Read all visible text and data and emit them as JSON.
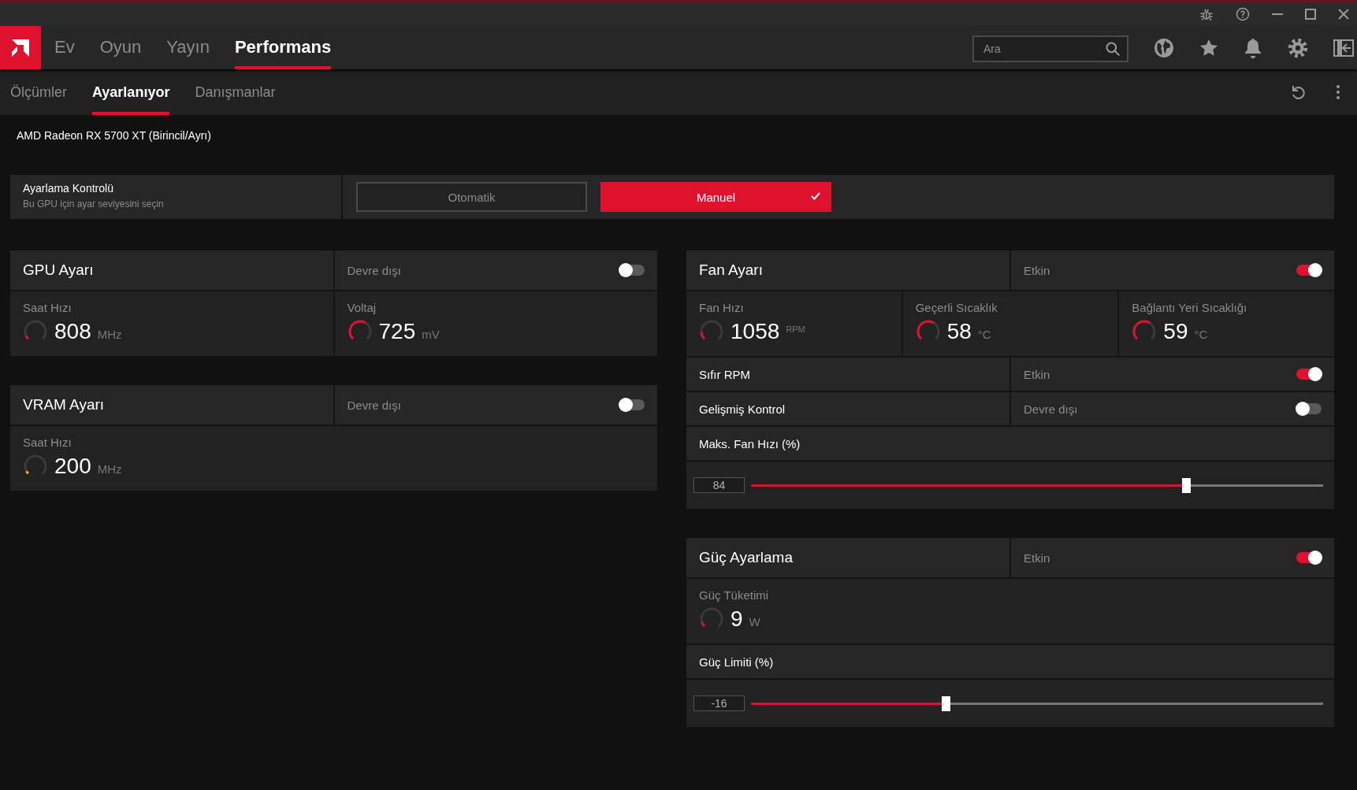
{
  "nav": {
    "tabs": [
      {
        "label": "Ev",
        "selected": false
      },
      {
        "label": "Oyun",
        "selected": false
      },
      {
        "label": "Yayın",
        "selected": false
      },
      {
        "label": "Performans",
        "selected": true
      }
    ],
    "search": {
      "placeholder": "Ara"
    }
  },
  "subnav": {
    "tabs": [
      {
        "label": "Ölçümler",
        "selected": false
      },
      {
        "label": "Ayarlanıyor",
        "selected": true
      },
      {
        "label": "Danışmanlar",
        "selected": false
      }
    ]
  },
  "gpu_name": "AMD Radeon RX 5700 XT (Birincil/Ayrı)",
  "tuning_control": {
    "title": "Ayarlama Kontrolü",
    "subtitle": "Bu GPU için ayar seviyesini seçin",
    "options": [
      {
        "label": "Otomatik",
        "selected": false
      },
      {
        "label": "Manuel",
        "selected": true
      }
    ]
  },
  "left_cards": [
    {
      "title": "GPU Ayarı",
      "status": "Devre dışı",
      "on": false,
      "metrics": [
        {
          "label": "Saat Hızı",
          "value": "808",
          "unit": "MHz",
          "level": 0.08,
          "color": "#e0102f"
        },
        {
          "label": "Voltaj",
          "value": "725",
          "unit": "mV",
          "level": 0.62,
          "color": "#e0102f"
        }
      ]
    },
    {
      "title": "VRAM Ayarı",
      "status": "Devre dışı",
      "on": false,
      "metrics": [
        {
          "label": "Saat Hızı",
          "value": "200",
          "unit": "MHz",
          "level": 0.06,
          "color": "#f0b400"
        }
      ]
    }
  ],
  "right_cards": [
    {
      "title": "Fan Ayarı",
      "status": "Etkin",
      "on": true,
      "metrics": [
        {
          "label": "Fan Hızı",
          "value": "1058",
          "unit": "RPM",
          "level": 0.15,
          "color": "#e0102f"
        },
        {
          "label": "Geçerli Sıcaklık",
          "value": "58",
          "unit": "°C",
          "level": 0.62,
          "color": "#e0102f"
        },
        {
          "label": "Bağlantı Yeri Sıcaklığı",
          "value": "59",
          "unit": "°C",
          "level": 0.62,
          "color": "#e0102f"
        }
      ],
      "rows": [
        {
          "kind": "toggle",
          "label": "Sıfır RPM",
          "status": "Etkin",
          "on": true
        },
        {
          "kind": "toggle",
          "label": "Gelişmiş Kontrol",
          "status": "Devre dışı",
          "on": false
        },
        {
          "kind": "slider",
          "label": "Maks. Fan Hızı (%)",
          "value": "84",
          "level": 0.76
        }
      ]
    },
    {
      "title": "Güç Ayarlama",
      "status": "Etkin",
      "on": true,
      "metrics": [
        {
          "label": "Güç Tüketimi",
          "value": "9",
          "unit": "W",
          "level": 0.1,
          "color": "#e0102f"
        }
      ],
      "rows": [
        {
          "kind": "slider",
          "label": "Güç Limiti (%)",
          "value": "-16",
          "level": 0.34
        }
      ]
    }
  ]
}
